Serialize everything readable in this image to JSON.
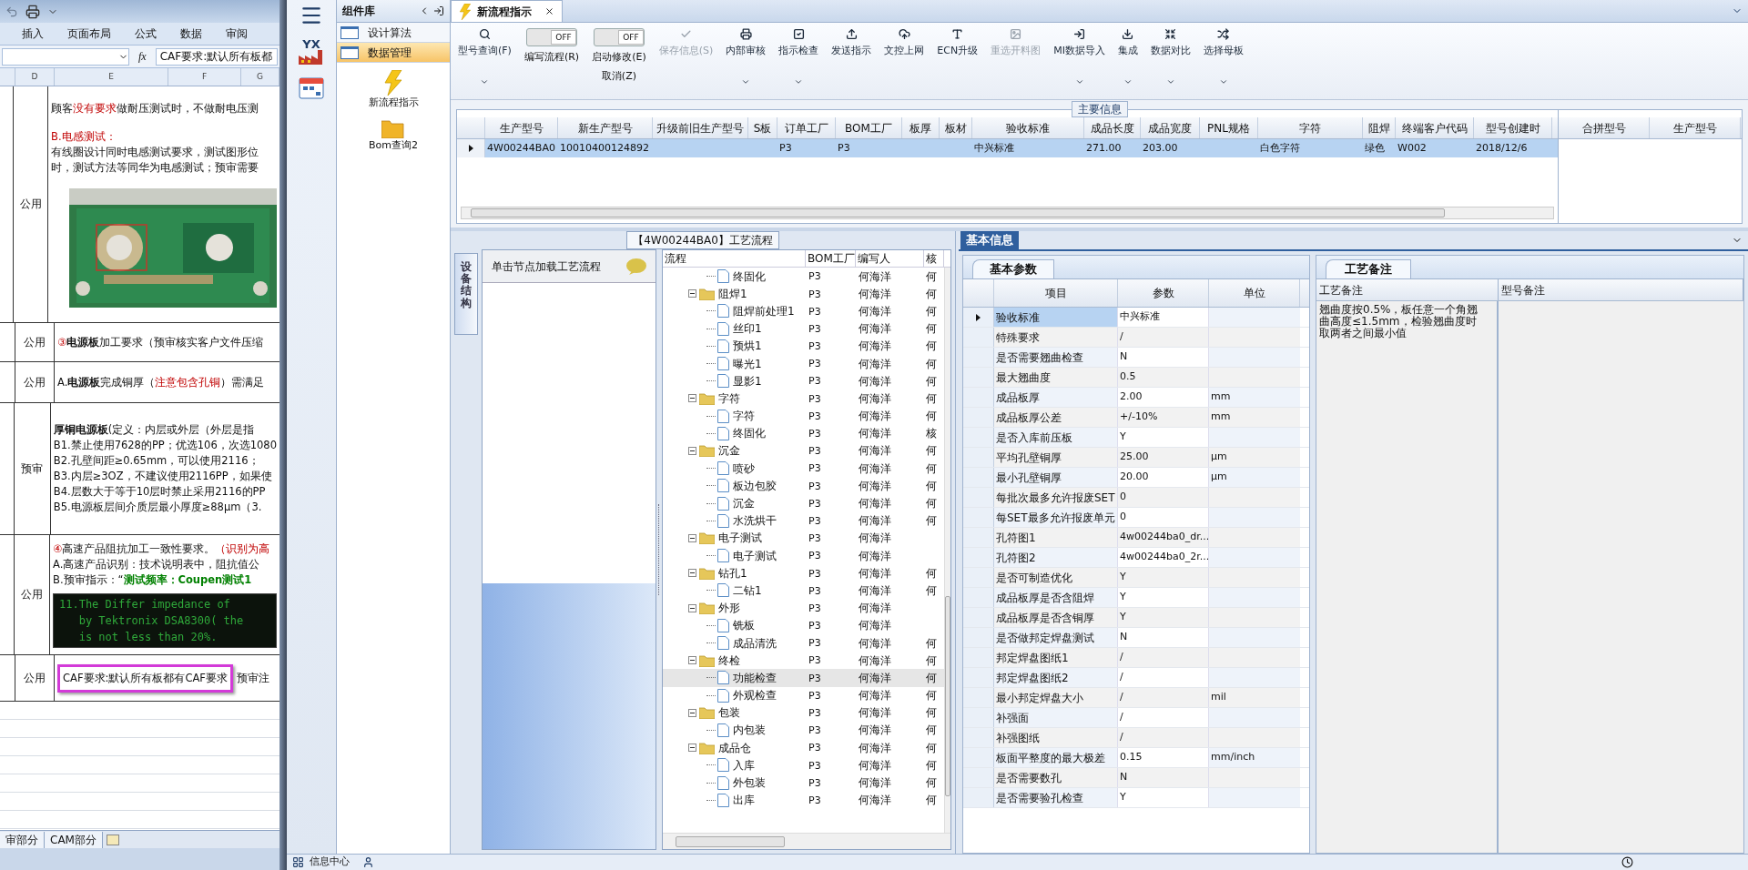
{
  "excel": {
    "ribbon_tabs": [
      "插入",
      "页面布局",
      "公式",
      "数据",
      "审阅"
    ],
    "formula_label": "fx",
    "formula": "CAF要求:默认所有板都",
    "columns": [
      "D",
      "E",
      "F",
      "G"
    ],
    "rows": [
      {
        "col_d": "公用",
        "lines": [
          {
            "kind": "text",
            "segments": [
              {
                "kind": "plain",
                "text": "顾客"
              },
              {
                "kind": "red",
                "text": "没有要求"
              },
              {
                "kind": "plain",
                "text": "做耐压测试时，不做耐电压测"
              }
            ]
          },
          {
            "kind": "heading",
            "segments": [
              {
                "kind": "red",
                "text": "B.电感测试："
              }
            ]
          },
          {
            "kind": "text",
            "segments": [
              {
                "kind": "plain",
                "text": "有线圈设计同时电感测试要求，测试图形位"
              }
            ]
          },
          {
            "kind": "text",
            "segments": [
              {
                "kind": "plain",
                "text": "时，测试方法等同华为电感测试；预审需要"
              }
            ]
          },
          {
            "kind": "picture"
          }
        ]
      },
      {
        "col_d": "公用",
        "lines": [
          {
            "kind": "text",
            "segments": [
              {
                "kind": "red",
                "text": "③"
              },
              {
                "kind": "bold",
                "text": "电源板"
              },
              {
                "kind": "plain",
                "text": "加工要求（预审核实客户文件压缩"
              }
            ]
          }
        ]
      },
      {
        "col_d": "公用",
        "lines": [
          {
            "kind": "text",
            "segments": [
              {
                "kind": "plain",
                "text": "A."
              },
              {
                "kind": "bold",
                "text": "电源板"
              },
              {
                "kind": "plain",
                "text": "完成铜厚（"
              },
              {
                "kind": "red",
                "text": "注意包含孔铜"
              },
              {
                "kind": "plain",
                "text": "）需满足"
              }
            ]
          }
        ]
      },
      {
        "col_d": "预审",
        "lines": [
          {
            "kind": "text",
            "segments": [
              {
                "kind": "bold",
                "text": "厚铜电源板"
              },
              {
                "kind": "plain",
                "text": "(定义：内层或外层（外层是指"
              }
            ]
          },
          {
            "kind": "text",
            "segments": [
              {
                "kind": "plain",
                "text": "B1.禁止使用7628的PP；优选106，次选1080"
              }
            ]
          },
          {
            "kind": "text",
            "segments": [
              {
                "kind": "plain",
                "text": "B2.孔壁间距≥0.65mm，可以使用2116；"
              }
            ]
          },
          {
            "kind": "text",
            "segments": [
              {
                "kind": "plain",
                "text": "B3.内层≥3OZ，不建议使用2116PP，如果使"
              }
            ]
          },
          {
            "kind": "text",
            "segments": [
              {
                "kind": "plain",
                "text": "B4.层数大于等于10层时禁止采用2116的PP"
              }
            ]
          },
          {
            "kind": "text",
            "segments": [
              {
                "kind": "plain",
                "text": "B5.电源板层间介质层最小厚度≥88μm（3."
              }
            ]
          }
        ]
      },
      {
        "col_d": "公用",
        "lines": [
          {
            "kind": "text",
            "segments": [
              {
                "kind": "red",
                "text": "④"
              },
              {
                "kind": "plain",
                "text": "高速产品阻抗加工一致性要求。"
              },
              {
                "kind": "red",
                "text": "（识别为高"
              }
            ]
          },
          {
            "kind": "text",
            "segments": [
              {
                "kind": "plain",
                "text": "A.高速产品识别：技术说明表中，阻抗值公"
              }
            ]
          },
          {
            "kind": "text",
            "segments": [
              {
                "kind": "plain",
                "text": "B.预审指示：“"
              },
              {
                "kind": "green",
                "text": "测试频率：Coupen测试1"
              }
            ]
          },
          {
            "kind": "screen",
            "lines": [
              "11.The Differ impedance of",
              "   by Tektronix DSA8300( the",
              "   is not less than 20%."
            ]
          }
        ]
      },
      {
        "col_d": "公用",
        "lines": [
          {
            "kind": "annotated",
            "boxed": "CAF要求:默认所有板都有CAF要求",
            "after": "预审注"
          }
        ]
      }
    ],
    "sheet_tabs": [
      "审部分",
      "CAM部分"
    ]
  },
  "rail": {
    "logo_text": "YX"
  },
  "components": {
    "title": "组件库",
    "items": [
      {
        "label": "设计算法",
        "selected": false
      },
      {
        "label": "数据管理",
        "selected": true
      }
    ],
    "tools": [
      {
        "label": "新流程指示",
        "kind": "lightning"
      },
      {
        "label": "Bom查询2",
        "kind": "folder"
      }
    ]
  },
  "tab": {
    "label": "新流程指示",
    "selected": true
  },
  "toolbar": [
    {
      "kind": "button",
      "label": "型号查询(F)",
      "disabled": false,
      "dropdown": true
    },
    {
      "kind": "toggle",
      "label": "编写流程(R)",
      "state": "OFF",
      "on": false
    },
    {
      "kind": "toggle",
      "label": "启动修改(E)",
      "sublabel": "取消(Z)",
      "state": "OFF",
      "on": false
    },
    {
      "kind": "button",
      "label": "保存信息(S)",
      "disabled": true,
      "dropdown": false
    },
    {
      "kind": "button",
      "label": "内部审核",
      "disabled": false,
      "dropdown": true
    },
    {
      "kind": "button",
      "label": "指示检查",
      "disabled": false,
      "dropdown": true
    },
    {
      "kind": "button",
      "label": "发送指示",
      "disabled": false,
      "dropdown": false
    },
    {
      "kind": "button",
      "label": "文控上网",
      "disabled": false,
      "dropdown": false
    },
    {
      "kind": "button",
      "label": "ECN升级",
      "disabled": false,
      "dropdown": false
    },
    {
      "kind": "button",
      "label": "重选开料图",
      "disabled": true,
      "dropdown": false
    },
    {
      "kind": "button",
      "label": "MI数据导入",
      "disabled": false,
      "dropdown": true
    },
    {
      "kind": "button",
      "label": "集成",
      "disabled": false,
      "dropdown": true
    },
    {
      "kind": "button",
      "label": "数据对比",
      "disabled": false,
      "dropdown": true
    },
    {
      "kind": "button",
      "label": "选择母板",
      "disabled": false,
      "dropdown": true
    }
  ],
  "main_info": {
    "title": "主要信息",
    "columns": [
      "生产型号",
      "新生产型号",
      "升级前旧生产型号",
      "S板",
      "订单工厂",
      "BOM工厂",
      "板厚",
      "板材",
      "验收标准",
      "成品长度",
      "成品宽度",
      "PNL规格",
      "字符",
      "阻焊",
      "终端客户代码",
      "型号创建时"
    ],
    "rows": [
      {
        "selected": true,
        "cells": [
          "4W00244BA0",
          "10010400124892",
          null,
          null,
          "P3",
          "P3",
          null,
          null,
          "中兴标准",
          "271.00",
          "203.00",
          null,
          "白色字符",
          "绿色",
          "W002",
          "2018/12/6"
        ]
      }
    ],
    "side_columns": [
      "合拼型号",
      "生产型号"
    ]
  },
  "process": {
    "title": "【4W00244BA0】工艺流程",
    "side_tab": "设备结构",
    "hint": "单击节点加载工艺流程",
    "columns": [
      "流程",
      "BOM工厂",
      "编写人",
      "核"
    ],
    "tree": [
      {
        "children": [
          {
            "label": "终固化",
            "kind": "file",
            "bom": "P3",
            "writer": "何海洋",
            "checker": "何",
            "selected": false
          }
        ]
      },
      {
        "label": "阻焊1",
        "kind": "folder",
        "expanded": true,
        "bom": "P3",
        "writer": "何海洋",
        "checker": "何",
        "selected": false,
        "children": [
          {
            "label": "阻焊前处理1",
            "kind": "file",
            "bom": "P3",
            "writer": "何海洋",
            "checker": "何",
            "selected": false
          },
          {
            "label": "丝印1",
            "kind": "file",
            "bom": "P3",
            "writer": "何海洋",
            "checker": "何",
            "selected": false
          },
          {
            "label": "预烘1",
            "kind": "file",
            "bom": "P3",
            "writer": "何海洋",
            "checker": "何",
            "selected": false
          },
          {
            "label": "曝光1",
            "kind": "file",
            "bom": "P3",
            "writer": "何海洋",
            "checker": "何",
            "selected": false
          },
          {
            "label": "显影1",
            "kind": "file",
            "bom": "P3",
            "writer": "何海洋",
            "checker": "何",
            "selected": false
          }
        ]
      },
      {
        "label": "字符",
        "kind": "folder",
        "expanded": true,
        "bom": "P3",
        "writer": "何海洋",
        "checker": "何",
        "selected": false,
        "children": [
          {
            "label": "字符",
            "kind": "file",
            "bom": "P3",
            "writer": "何海洋",
            "checker": "何",
            "selected": false
          },
          {
            "label": "终固化",
            "kind": "file",
            "bom": "P3",
            "writer": "何海洋",
            "checker": "核",
            "selected": false
          }
        ]
      },
      {
        "label": "沉金",
        "kind": "folder",
        "expanded": true,
        "bom": "P3",
        "writer": "何海洋",
        "checker": "何",
        "selected": false,
        "children": [
          {
            "label": "喷砂",
            "kind": "file",
            "bom": "P3",
            "writer": "何海洋",
            "checker": "何",
            "selected": false
          },
          {
            "label": "板边包胶",
            "kind": "file",
            "bom": "P3",
            "writer": "何海洋",
            "checker": "何",
            "selected": false
          },
          {
            "label": "沉金",
            "kind": "file",
            "bom": "P3",
            "writer": "何海洋",
            "checker": "何",
            "selected": false
          },
          {
            "label": "水洗烘干",
            "kind": "file",
            "bom": "P3",
            "writer": "何海洋",
            "checker": "何",
            "selected": false
          }
        ]
      },
      {
        "label": "电子测试",
        "kind": "folder",
        "expanded": true,
        "bom": "P3",
        "writer": "何海洋",
        "selected": false,
        "children": [
          {
            "label": "电子测试",
            "kind": "file",
            "bom": "P3",
            "writer": "何海洋",
            "selected": false
          }
        ]
      },
      {
        "label": "钻孔1",
        "kind": "folder",
        "expanded": true,
        "bom": "P3",
        "writer": "何海洋",
        "checker": "何",
        "selected": false,
        "children": [
          {
            "label": "二钻1",
            "kind": "file",
            "bom": "P3",
            "writer": "何海洋",
            "checker": "何",
            "selected": false
          }
        ]
      },
      {
        "label": "外形",
        "kind": "folder",
        "expanded": true,
        "bom": "P3",
        "writer": "何海洋",
        "selected": false,
        "children": [
          {
            "label": "铣板",
            "kind": "file",
            "bom": "P3",
            "writer": "何海洋",
            "selected": false
          },
          {
            "label": "成品清洗",
            "kind": "file",
            "bom": "P3",
            "writer": "何海洋",
            "checker": "何",
            "selected": false
          }
        ]
      },
      {
        "label": "终检",
        "kind": "folder",
        "expanded": true,
        "bom": "P3",
        "writer": "何海洋",
        "checker": "何",
        "selected": false,
        "children": [
          {
            "label": "功能检查",
            "kind": "file",
            "bom": "P3",
            "writer": "何海洋",
            "checker": "何",
            "selected": true
          },
          {
            "label": "外观检查",
            "kind": "file",
            "bom": "P3",
            "writer": "何海洋",
            "checker": "何",
            "selected": false
          }
        ]
      },
      {
        "label": "包装",
        "kind": "folder",
        "expanded": true,
        "bom": "P3",
        "writer": "何海洋",
        "checker": "何",
        "selected": false,
        "children": [
          {
            "label": "内包装",
            "kind": "file",
            "bom": "P3",
            "writer": "何海洋",
            "checker": "何",
            "selected": false
          }
        ]
      },
      {
        "label": "成品仓",
        "kind": "folder",
        "expanded": true,
        "bom": "P3",
        "writer": "何海洋",
        "checker": "何",
        "selected": false,
        "children": [
          {
            "label": "入库",
            "kind": "file",
            "bom": "P3",
            "writer": "何海洋",
            "checker": "何",
            "selected": false
          },
          {
            "label": "外包装",
            "kind": "file",
            "bom": "P3",
            "writer": "何海洋",
            "checker": "何",
            "selected": false
          },
          {
            "label": "出库",
            "kind": "file",
            "bom": "P3",
            "writer": "何海洋",
            "checker": "何",
            "selected": false
          }
        ]
      }
    ]
  },
  "basic_info": {
    "title": "基本信息",
    "params_tab": "基本参数",
    "columns": [
      "项目",
      "参数",
      "单位"
    ],
    "rows": [
      {
        "item": "验收标准",
        "value": "中兴标准",
        "selected": true
      },
      {
        "item": "特殊要求",
        "value": "/",
        "selected": false
      },
      {
        "item": "是否需要翘曲检查",
        "value": "N",
        "selected": false
      },
      {
        "item": "最大翘曲度",
        "value": "0.5",
        "selected": false
      },
      {
        "item": "成品板厚",
        "value": "2.00",
        "unit": "mm",
        "selected": false
      },
      {
        "item": "成品板厚公差",
        "value": "+/-10%",
        "unit": "mm",
        "selected": false
      },
      {
        "item": "是否入库前压板",
        "value": "Y",
        "selected": false
      },
      {
        "item": "平均孔壁铜厚",
        "value": "25.00",
        "unit": "μm",
        "selected": false
      },
      {
        "item": "最小孔壁铜厚",
        "value": "20.00",
        "unit": "μm",
        "selected": false
      },
      {
        "item": "每批次最多允许报废SET",
        "value": "0",
        "selected": false
      },
      {
        "item": "每SET最多允许报废单元",
        "value": "0",
        "selected": false
      },
      {
        "item": "孔符图1",
        "value": "4w00244ba0_dr...",
        "selected": false
      },
      {
        "item": "孔符图2",
        "value": "4w00244ba0_2r...",
        "selected": false
      },
      {
        "item": "是否可制造优化",
        "value": "Y",
        "selected": false
      },
      {
        "item": "成品板厚是否含阻焊",
        "value": "Y",
        "selected": false
      },
      {
        "item": "成品板厚是否含铜厚",
        "value": "Y",
        "selected": false
      },
      {
        "item": "是否做邦定焊盘测试",
        "value": "N",
        "selected": false
      },
      {
        "item": "邦定焊盘图纸1",
        "value": "/",
        "selected": false
      },
      {
        "item": "邦定焊盘图纸2",
        "value": "/",
        "selected": false
      },
      {
        "item": "最小邦定焊盘大小",
        "value": "/",
        "unit": "mil",
        "selected": false
      },
      {
        "item": "补强面",
        "value": "/",
        "selected": false
      },
      {
        "item": "补强图纸",
        "value": "/",
        "selected": false
      },
      {
        "item": "板面平整度的最大极差",
        "value": "0.15",
        "unit": "mm/inch",
        "selected": false
      },
      {
        "item": "是否需要数孔",
        "value": "N",
        "selected": false
      },
      {
        "item": "是否需要验孔检查",
        "value": "Y",
        "selected": false
      }
    ],
    "remarks_tab": "工艺备注",
    "remark_columns": [
      "工艺备注",
      "型号备注"
    ],
    "process_note": "翘曲度按0.5%，板任意一个角翘曲高度≤1.5mm，检验翘曲度时取两者之间最小值"
  },
  "status_bar": {
    "items": [
      "信息中心"
    ]
  }
}
